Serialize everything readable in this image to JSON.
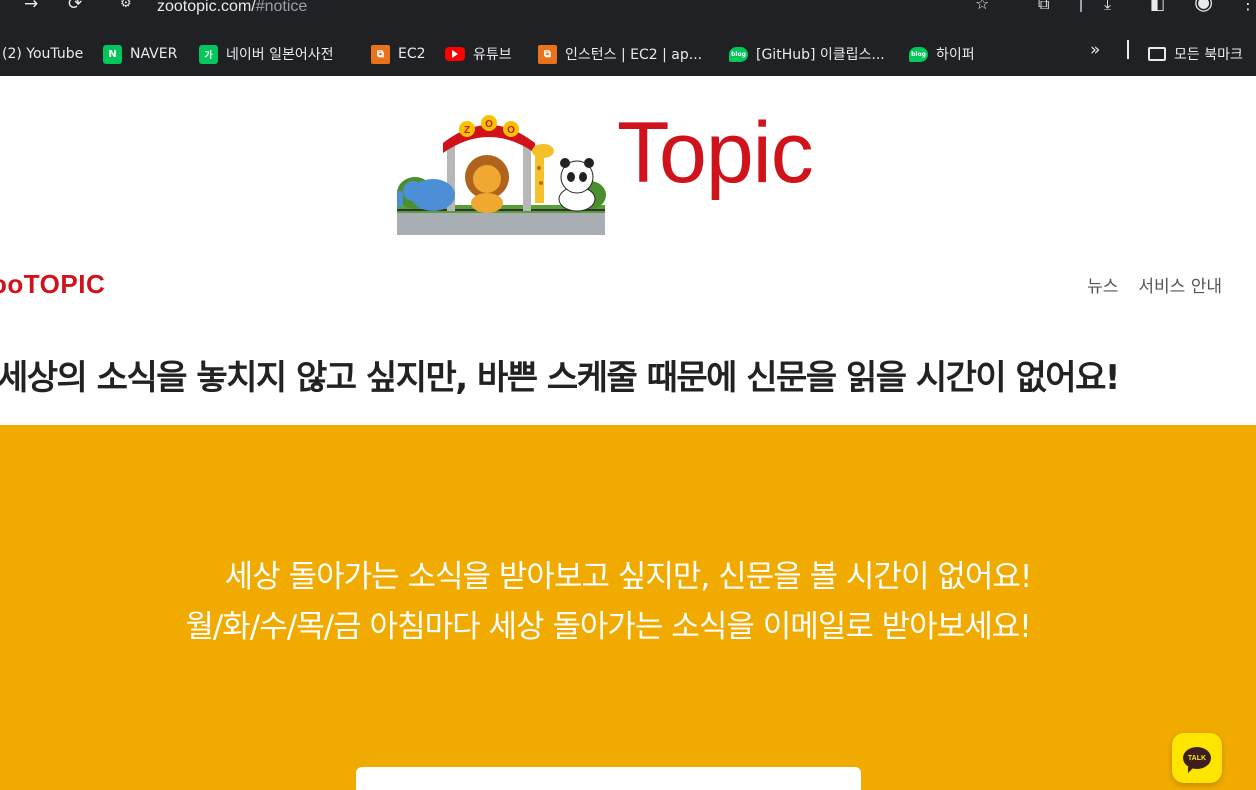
{
  "browser": {
    "url_domain": "zootopic.com/",
    "url_path": "#notice",
    "colors": {
      "chrome_bg": "#202124",
      "chrome_text": "#e8eaed"
    }
  },
  "bookmarks": [
    {
      "label": "(2) YouTube",
      "icon": "youtube-icon"
    },
    {
      "label": "NAVER",
      "icon": "naver-icon",
      "badge": "N"
    },
    {
      "label": "네이버 일본어사전",
      "icon": "naver-dictionary-icon",
      "badge": "가"
    },
    {
      "label": "EC2",
      "icon": "aws-icon"
    },
    {
      "label": "유튜브",
      "icon": "youtube-icon"
    },
    {
      "label": "인스턴스 | EC2 | ap...",
      "icon": "aws-icon"
    },
    {
      "label": "[GitHub] 이클립스...",
      "icon": "naver-blog-icon",
      "badge": "blog"
    },
    {
      "label": "하이퍼",
      "icon": "naver-blog-icon",
      "badge": "blog"
    }
  ],
  "bookmarks_more": "»",
  "all_bookmarks_label": "모든 북마크",
  "site": {
    "logo_text": "Topic",
    "brand": "ooTOPIC",
    "nav": [
      "뉴스",
      "서비스 안내"
    ],
    "headline": "세상의 소식을 놓치지 않고 싶지만, 바쁜 스케줄 때문에 신문을 읽을 시간이 없어요!",
    "banner": {
      "line1": "세상 돌아가는 소식을 받아보고 싶지만, 신문을 볼 시간이 없어요!",
      "line2": "월/화/수/목/금 아침마다 세상 돌아가는 소식을 이메일로 받아보세요!"
    },
    "talk_label": "TALK",
    "colors": {
      "brand_red": "#d0121b",
      "banner_yellow": "#f0aa00",
      "kakao_yellow": "#fee500"
    }
  }
}
